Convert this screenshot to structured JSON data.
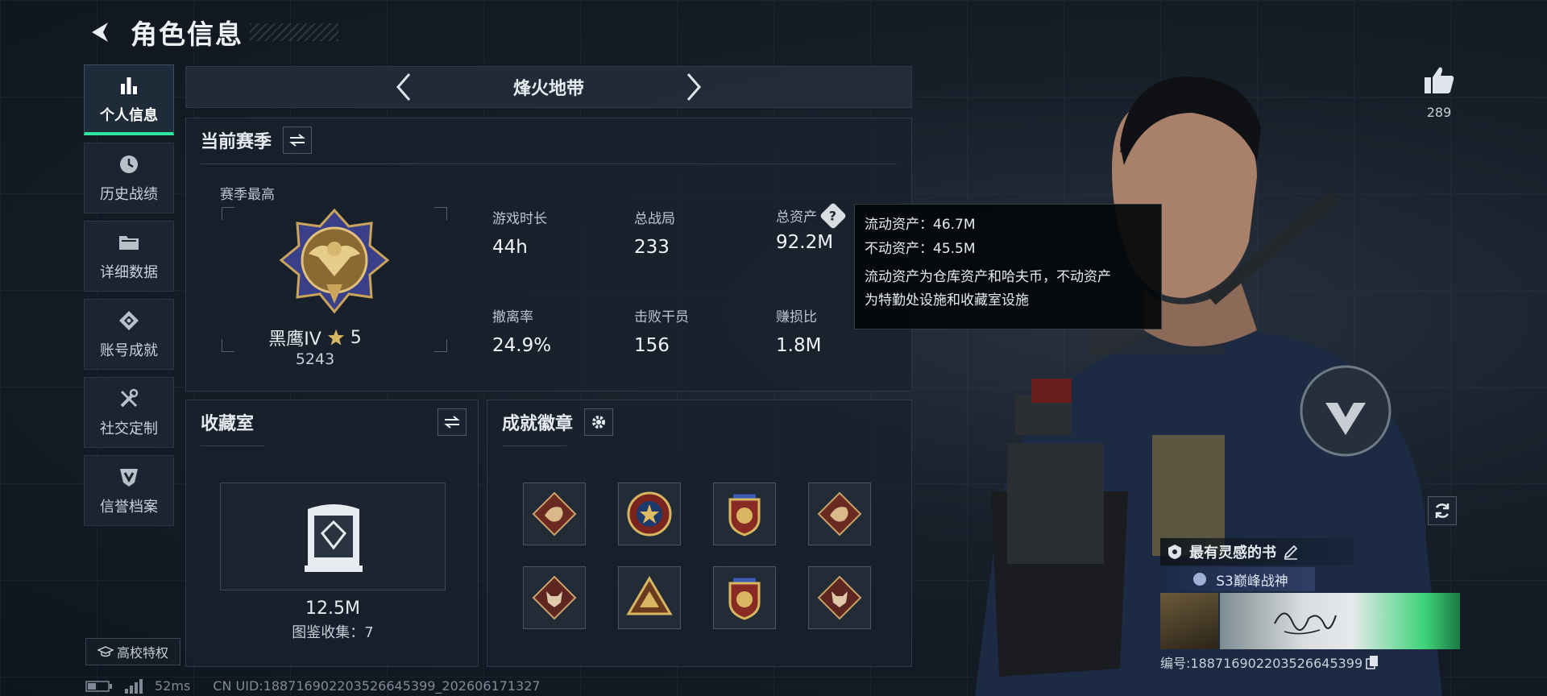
{
  "header": {
    "title": "角色信息"
  },
  "nav": [
    {
      "label": "个人信息",
      "icon": "bar-chart-icon",
      "active": true
    },
    {
      "label": "历史战绩",
      "icon": "history-clock-icon"
    },
    {
      "label": "详细数据",
      "icon": "folder-icon"
    },
    {
      "label": "账号成就",
      "icon": "achievement-icon"
    },
    {
      "label": "社交定制",
      "icon": "tools-icon"
    },
    {
      "label": "信誉档案",
      "icon": "shield-v-icon"
    }
  ],
  "school_privilege": "高校特权",
  "mode": {
    "title": "烽火地带"
  },
  "season": {
    "heading": "当前赛季",
    "best_label": "赛季最高",
    "rank_name": "黑鹰IV",
    "rank_stars": "5",
    "rank_score": "5243",
    "stats": [
      {
        "label": "游戏时长",
        "value": "44h"
      },
      {
        "label": "总战局",
        "value": "233"
      },
      {
        "label": "总资产",
        "value": "92.2M"
      },
      {
        "label": "撤离率",
        "value": "24.9%"
      },
      {
        "label": "击败干员",
        "value": "156"
      },
      {
        "label": "赚损比",
        "value": "1.8M"
      }
    ]
  },
  "tooltip": {
    "line1": "流动资产：46.7M",
    "line2": "不动资产：45.5M",
    "desc1": "流动资产为仓库资产和哈夫币，不动资产",
    "desc2": "为特勤处设施和收藏室设施"
  },
  "collection": {
    "heading": "收藏室",
    "value": "12.5M",
    "label": "图鉴收集：7"
  },
  "achievements": {
    "heading": "成就徽章"
  },
  "likes": {
    "count": "289"
  },
  "card": {
    "title": "最有灵感的书",
    "subtitle": "S3巅峰战神",
    "id_text": "编号:188716902203526645399"
  },
  "footer": {
    "ping": "52ms",
    "uid": "CN UID:188716902203526645399_202606171327"
  },
  "colors": {
    "accent": "#2ee6a0",
    "background": "#101722",
    "gold": "#c9a45a"
  }
}
